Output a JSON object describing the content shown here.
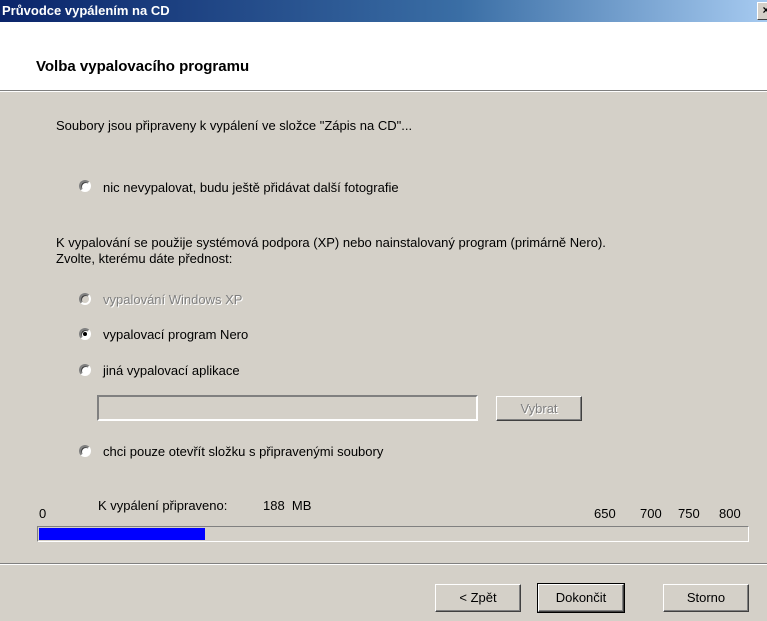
{
  "window": {
    "title": "Průvodce vypálením na CD",
    "close_label": "×"
  },
  "header": {
    "title": "Volba vypalovacího programu"
  },
  "intro": "Soubory jsou připraveny k vypálení ve složce \"Zápis na CD\"...",
  "option_none": {
    "label": "nic nevypalovat, budu ještě přidávat další fotografie",
    "selected": false
  },
  "explanation": {
    "line1": "K vypalování se použije systémová podpora (XP) nebo nainstalovaný program (primárně Nero).",
    "line2": "Zvolte, kterému dáte přednost:"
  },
  "options": {
    "xp": {
      "label": "vypalování Windows XP",
      "selected": false,
      "disabled": true
    },
    "nero": {
      "label": "vypalovací program Nero",
      "selected": true
    },
    "other": {
      "label": "jiná vypalovací aplikace",
      "selected": false
    },
    "folder": {
      "label": "chci pouze otevřít složku s připravenými soubory",
      "selected": false
    }
  },
  "other_app": {
    "path_value": "",
    "browse_label": "Vybrat"
  },
  "capacity": {
    "prepared_label": "K vypálení připraveno:",
    "prepared_value": "188  MB",
    "scale_start": "0",
    "scale_marks": [
      "650",
      "700",
      "750",
      "800"
    ],
    "used_mb": 188,
    "max_mb": 800
  },
  "buttons": {
    "back": "< Zpět",
    "finish": "Dokončit",
    "cancel": "Storno"
  }
}
